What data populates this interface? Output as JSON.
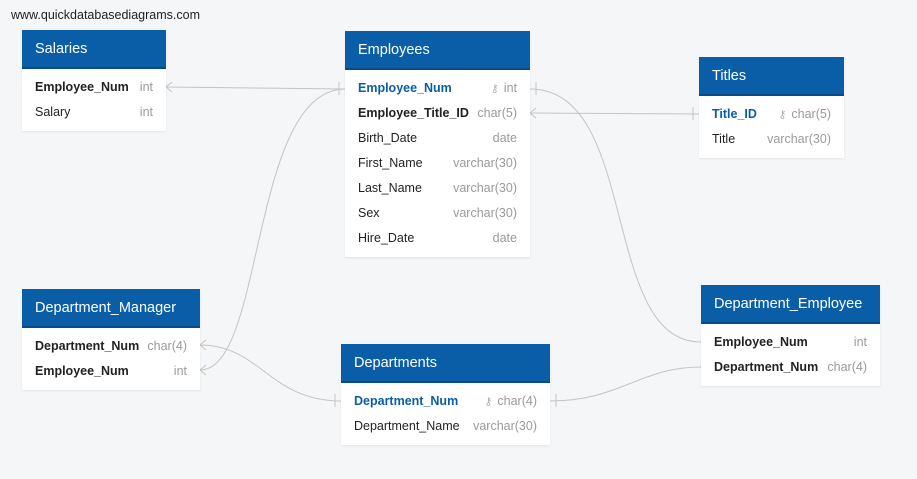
{
  "watermark": "www.quickdatabasediagrams.com",
  "tables": {
    "salaries": {
      "name": "Salaries",
      "columns": [
        {
          "name": "Employee_Num",
          "type": "int"
        },
        {
          "name": "Salary",
          "type": "int"
        }
      ]
    },
    "employees": {
      "name": "Employees",
      "columns": [
        {
          "name": "Employee_Num",
          "type": "int"
        },
        {
          "name": "Employee_Title_ID",
          "type": "char(5)"
        },
        {
          "name": "Birth_Date",
          "type": "date"
        },
        {
          "name": "First_Name",
          "type": "varchar(30)"
        },
        {
          "name": "Last_Name",
          "type": "varchar(30)"
        },
        {
          "name": "Sex",
          "type": "varchar(30)"
        },
        {
          "name": "Hire_Date",
          "type": "date"
        }
      ]
    },
    "titles": {
      "name": "Titles",
      "columns": [
        {
          "name": "Title_ID",
          "type": "char(5)"
        },
        {
          "name": "Title",
          "type": "varchar(30)"
        }
      ]
    },
    "department_manager": {
      "name": "Department_Manager",
      "columns": [
        {
          "name": "Department_Num",
          "type": "char(4)"
        },
        {
          "name": "Employee_Num",
          "type": "int"
        }
      ]
    },
    "departments": {
      "name": "Departments",
      "columns": [
        {
          "name": "Department_Num",
          "type": "char(4)"
        },
        {
          "name": "Department_Name",
          "type": "varchar(30)"
        }
      ]
    },
    "department_employee": {
      "name": "Department_Employee",
      "columns": [
        {
          "name": "Employee_Num",
          "type": "int"
        },
        {
          "name": "Department_Num",
          "type": "char(4)"
        }
      ]
    }
  },
  "colors": {
    "header": "#0a5ea8",
    "primary_key_text": "#0a5ea8",
    "type_text": "#9a9a9a",
    "relationship_line": "#c4c4c4",
    "background": "#f5f6f7"
  },
  "icons": {
    "primary_key": "key-icon"
  }
}
